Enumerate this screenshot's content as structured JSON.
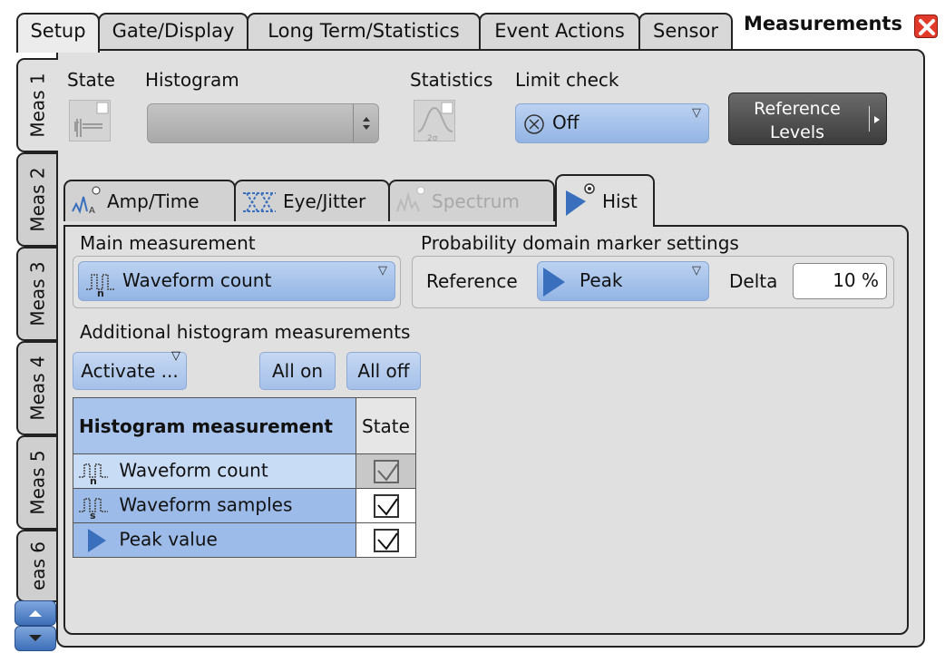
{
  "dialog": {
    "title": "Measurements",
    "tabs": [
      "Setup",
      "Gate/Display",
      "Long Term/Statistics",
      "Event Actions",
      "Sensor"
    ],
    "active_tab": "Setup"
  },
  "side_tabs": [
    "Meas 1",
    "Meas 2",
    "Meas 3",
    "Meas 4",
    "Meas 5",
    "eas 6"
  ],
  "top_row": {
    "state_label": "State",
    "histogram_label": "Histogram",
    "histogram_value": "",
    "statistics_label": "Statistics",
    "statistics_icon_text": "2σ",
    "limit_check_label": "Limit check",
    "limit_check_value": "Off",
    "reference_levels_line1": "Reference",
    "reference_levels_line2": "Levels"
  },
  "sub_tabs": [
    {
      "label": "Amp/Time",
      "state": "normal"
    },
    {
      "label": "Eye/Jitter",
      "state": "normal"
    },
    {
      "label": "Spectrum",
      "state": "disabled"
    },
    {
      "label": "Hist",
      "state": "active"
    }
  ],
  "main_measurement": {
    "label": "Main measurement",
    "value": "Waveform count"
  },
  "probability": {
    "label": "Probability domain marker settings",
    "reference_label": "Reference",
    "reference_value": "Peak",
    "delta_label": "Delta",
    "delta_value": "10 %"
  },
  "additional": {
    "label": "Additional histogram measurements",
    "activate_label": "Activate ...",
    "all_on_label": "All on",
    "all_off_label": "All off"
  },
  "table": {
    "header_name": "Histogram measurement",
    "header_state": "State",
    "rows": [
      {
        "name": "Waveform count",
        "icon_sub": "n",
        "checked": true
      },
      {
        "name": "Waveform samples",
        "icon_sub": "s",
        "checked": true
      },
      {
        "name": "Peak value",
        "icon_sub": "",
        "checked": true
      }
    ]
  },
  "colors": {
    "accent_blue": "#a5c0e9",
    "close_red": "#e23a2a",
    "panel_grey": "#e0e0e0"
  }
}
